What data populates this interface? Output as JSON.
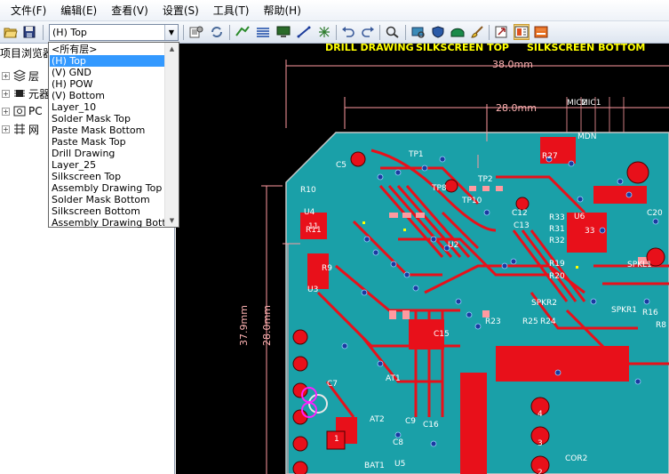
{
  "menu": [
    "文件(F)",
    "编辑(E)",
    "查看(V)",
    "设置(S)",
    "工具(T)",
    "帮助(H)"
  ],
  "toolbar": {
    "layer_select_value": "(H) Top"
  },
  "left_panel": {
    "title": "项目浏览器",
    "tree": [
      {
        "label": "层",
        "icon": "layers-icon"
      },
      {
        "label": "元器",
        "icon": "component-icon"
      },
      {
        "label": "PC",
        "icon": "pcb-icon"
      },
      {
        "label": "网",
        "icon": "net-icon"
      }
    ]
  },
  "layer_dropdown": {
    "items": [
      "<所有层>",
      "(H) Top",
      "(V) GND",
      "(H) POW",
      "(V) Bottom",
      "Layer_10",
      "Solder Mask Top",
      "Paste Mask Bottom",
      "Paste Mask Top",
      "Drill Drawing",
      "Layer_25",
      "Silkscreen Top",
      "Assembly Drawing Top",
      "Solder Mask Bottom",
      "Silkscreen Bottom",
      "Assembly Drawing Botto"
    ],
    "selected_index": 1
  },
  "canvas": {
    "layer_tabs": [
      "DRILL DRAWING",
      "SILKSCREEN TOP",
      "SILKSCREEN BOTTOM"
    ],
    "dimensions": {
      "top_38": "38.0mm",
      "top_28": "28.0mm",
      "left_37": "37.9mm",
      "left_28": "28.0mm"
    },
    "component_labels": [
      "U6",
      "33",
      "U2",
      "U4",
      "U3",
      "U5",
      "TP1",
      "TP8",
      "TP10",
      "TP2",
      "R27",
      "R33",
      "R31",
      "R32",
      "R19",
      "R20",
      "R23",
      "R25",
      "R24",
      "R16",
      "R8",
      "R9",
      "R10",
      "R11",
      "SPKR2",
      "SPKR1",
      "SPKL1",
      "C5",
      "C7",
      "C8",
      "C9",
      "C15",
      "C16",
      "C20",
      "C12",
      "C13",
      "AT1",
      "AT2",
      "BAT1",
      "MDN",
      "MIC2",
      "MIC1",
      "COR2",
      "4",
      "3",
      "2",
      "11",
      "1"
    ],
    "colors": {
      "copper": "#e8101a",
      "board": "#1aa0a8",
      "background": "#000000",
      "dimension": "#ff9aa0",
      "via": "#1a3aa0",
      "silk": "#ffff00"
    }
  }
}
